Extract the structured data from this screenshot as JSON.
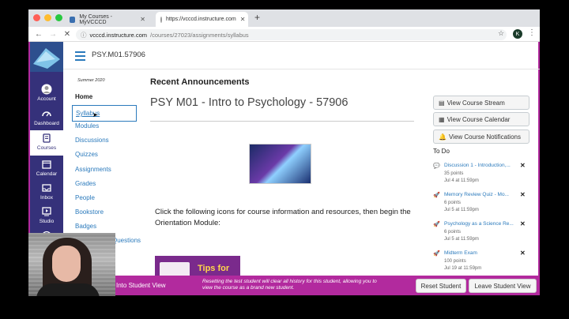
{
  "browser": {
    "tabs": [
      {
        "label": "My Courses - MyVCCCD",
        "active": false
      },
      {
        "label": "https://vcccd.instructure.com",
        "active": true
      }
    ],
    "url_host": "vcccd.instructure.com",
    "url_path": "/courses/27023/assignments/syllabus",
    "profile_initial": "K"
  },
  "global_nav": [
    {
      "label": "Account",
      "icon": "account-icon"
    },
    {
      "label": "Dashboard",
      "icon": "dashboard-icon"
    },
    {
      "label": "Courses",
      "icon": "courses-icon",
      "active": true
    },
    {
      "label": "Calendar",
      "icon": "calendar-icon"
    },
    {
      "label": "Inbox",
      "icon": "inbox-icon"
    },
    {
      "label": "Studio",
      "icon": "studio-icon"
    }
  ],
  "header": {
    "breadcrumb": "PSY.M01.57906"
  },
  "course_nav": {
    "term": "Summer 2020",
    "items": [
      "Home",
      "Syllabus",
      "Modules",
      "Discussions",
      "Quizzes",
      "Assignments",
      "Grades",
      "People",
      "Bookstore",
      "Badges",
      "Questions"
    ]
  },
  "main": {
    "announcements_heading": "Recent Announcements",
    "title": "PSY M01 - Intro to Psychology - 57906",
    "intro": "Click the following icons for course information and resources, then begin the Orientation Module:",
    "tips_text": "Tips for"
  },
  "sidebar": {
    "buttons": [
      "View Course Stream",
      "View Course Calendar",
      "View Course Notifications"
    ],
    "todo_heading": "To Do",
    "todo": [
      {
        "name": "Discussion 1 - Introduction,...",
        "points": "35 points",
        "due": "Jul 4 at 11:59pm"
      },
      {
        "name": "Memory Review Quiz - Mo...",
        "points": "6 points",
        "due": "Jul 5 at 11:59pm"
      },
      {
        "name": "Psychology as a Science Re...",
        "points": "6 points",
        "due": "Jul 5 at 11:59pm"
      },
      {
        "name": "Midterm Exam",
        "points": "100 points",
        "due": "Jul 19 at 11:59pm"
      }
    ]
  },
  "student_view": {
    "label": "Into Student View",
    "message": "Resetting the test student will clear all history for this student, allowing you to view the course as a brand new student.",
    "reset_label": "Reset Student",
    "leave_label": "Leave Student View"
  },
  "colors": {
    "nav_bg": "#35317a",
    "link": "#2b7abc",
    "student_bar": "#b22a9e"
  }
}
